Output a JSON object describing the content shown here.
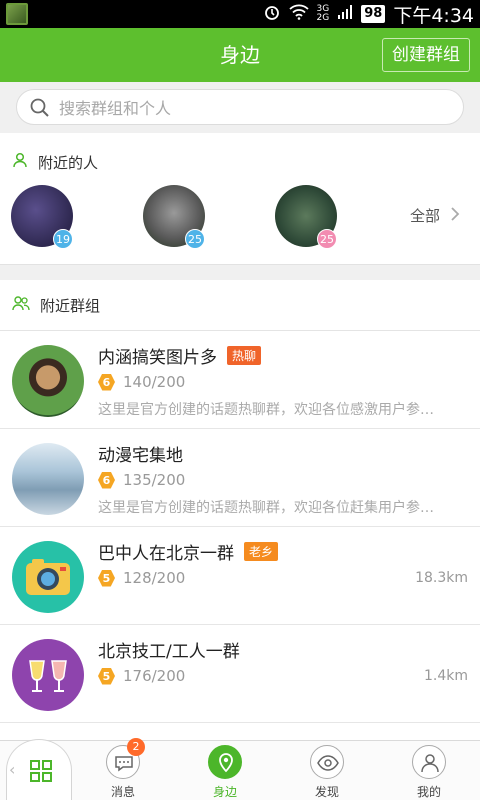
{
  "status_bar": {
    "battery": "98",
    "time": "下午4:34",
    "net_top": "3G",
    "net_bottom": "2G"
  },
  "header": {
    "title": "身边",
    "create_group_label": "创建群组"
  },
  "search": {
    "placeholder": "搜索群组和个人"
  },
  "nearby_people": {
    "title": "附近的人",
    "people": [
      {
        "age": "19",
        "badge_color": "#4fb3e8"
      },
      {
        "age": "25",
        "badge_color": "#4fb3e8"
      },
      {
        "age": "25",
        "badge_color": "#f28cb1"
      }
    ],
    "all_label": "全部"
  },
  "nearby_groups": {
    "title": "附近群组",
    "groups": [
      {
        "name": "内涵搞笑图片多",
        "tag": "热聊",
        "tag_color": "#f0642a",
        "level": "6",
        "members": "140/200",
        "desc": "这里是官方创建的话题热聊群，欢迎各位感激用户参…",
        "distance": ""
      },
      {
        "name": "动漫宅集地",
        "tag": "",
        "tag_color": "",
        "level": "6",
        "members": "135/200",
        "desc": "这里是官方创建的话题热聊群，欢迎各位赶集用户参…",
        "distance": ""
      },
      {
        "name": "巴中人在北京一群",
        "tag": "老乡",
        "tag_color": "#f58b1f",
        "level": "5",
        "members": "128/200",
        "desc": "",
        "distance": "18.3km"
      },
      {
        "name": "北京技工/工人一群",
        "tag": "",
        "tag_color": "",
        "level": "5",
        "members": "176/200",
        "desc": "",
        "distance": "1.4km"
      }
    ]
  },
  "bottom_nav": {
    "items": [
      {
        "label": "消息",
        "badge": "2"
      },
      {
        "label": "身边"
      },
      {
        "label": "发现"
      },
      {
        "label": "我的"
      }
    ]
  },
  "colors": {
    "brand_green": "#5dbf2e",
    "hot_tag": "#f0642a",
    "level_badge": "#f5a623"
  }
}
